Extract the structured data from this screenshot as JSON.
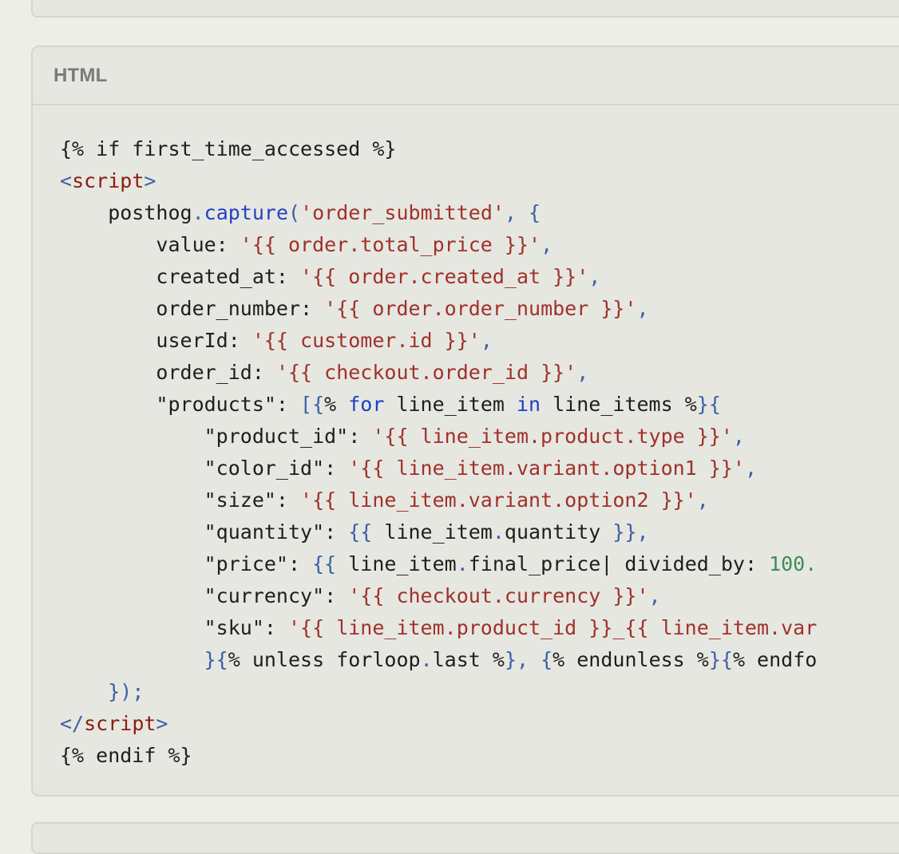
{
  "panel": {
    "label": "HTML"
  },
  "code": {
    "lines": [
      [
        {
          "t": "{% if first_time_accessed %}",
          "c": ""
        }
      ],
      [
        {
          "t": "<",
          "c": "punct"
        },
        {
          "t": "script",
          "c": "tag"
        },
        {
          "t": ">",
          "c": "punct"
        }
      ],
      [
        {
          "t": "    posthog",
          "c": ""
        },
        {
          "t": ".",
          "c": "punct"
        },
        {
          "t": "capture",
          "c": "fn"
        },
        {
          "t": "(",
          "c": "punct"
        },
        {
          "t": "'order_submitted'",
          "c": "str"
        },
        {
          "t": ", ",
          "c": "punct"
        },
        {
          "t": "{",
          "c": "punct"
        }
      ],
      [
        {
          "t": "        value: ",
          "c": ""
        },
        {
          "t": "'{{ order.total_price }}'",
          "c": "str"
        },
        {
          "t": ",",
          "c": "punct"
        }
      ],
      [
        {
          "t": "        created_at: ",
          "c": ""
        },
        {
          "t": "'{{ order.created_at }}'",
          "c": "str"
        },
        {
          "t": ",",
          "c": "punct"
        }
      ],
      [
        {
          "t": "        order_number: ",
          "c": ""
        },
        {
          "t": "'{{ order.order_number }}'",
          "c": "str"
        },
        {
          "t": ",",
          "c": "punct"
        }
      ],
      [
        {
          "t": "        userId: ",
          "c": ""
        },
        {
          "t": "'{{ customer.id }}'",
          "c": "str"
        },
        {
          "t": ",",
          "c": "punct"
        }
      ],
      [
        {
          "t": "        order_id: ",
          "c": ""
        },
        {
          "t": "'{{ checkout.order_id }}'",
          "c": "str"
        },
        {
          "t": ",",
          "c": "punct"
        }
      ],
      [
        {
          "t": "        \"products\": ",
          "c": ""
        },
        {
          "t": "[{",
          "c": "punct"
        },
        {
          "t": "% ",
          "c": ""
        },
        {
          "t": "for",
          "c": "kw"
        },
        {
          "t": " line_item ",
          "c": ""
        },
        {
          "t": "in",
          "c": "kw"
        },
        {
          "t": " line_items %",
          "c": ""
        },
        {
          "t": "}{",
          "c": "punct"
        }
      ],
      [
        {
          "t": "            \"product_id\": ",
          "c": ""
        },
        {
          "t": "'{{ line_item.product.type }}'",
          "c": "str"
        },
        {
          "t": ",",
          "c": "punct"
        }
      ],
      [
        {
          "t": "            \"color_id\": ",
          "c": ""
        },
        {
          "t": "'{{ line_item.variant.option1 }}'",
          "c": "str"
        },
        {
          "t": ",",
          "c": "punct"
        }
      ],
      [
        {
          "t": "            \"size\": ",
          "c": ""
        },
        {
          "t": "'{{ line_item.variant.option2 }}'",
          "c": "str"
        },
        {
          "t": ",",
          "c": "punct"
        }
      ],
      [
        {
          "t": "            \"quantity\": ",
          "c": ""
        },
        {
          "t": "{{",
          "c": "punct"
        },
        {
          "t": " line_item",
          "c": ""
        },
        {
          "t": ".",
          "c": "punct"
        },
        {
          "t": "quantity ",
          "c": ""
        },
        {
          "t": "}},",
          "c": "punct"
        }
      ],
      [
        {
          "t": "            \"price\": ",
          "c": ""
        },
        {
          "t": "{{",
          "c": "punct"
        },
        {
          "t": " line_item",
          "c": ""
        },
        {
          "t": ".",
          "c": "punct"
        },
        {
          "t": "final_price| divided_by: ",
          "c": ""
        },
        {
          "t": "100.",
          "c": "num"
        }
      ],
      [
        {
          "t": "            \"currency\": ",
          "c": ""
        },
        {
          "t": "'{{ checkout.currency }}'",
          "c": "str"
        },
        {
          "t": ",",
          "c": "punct"
        }
      ],
      [
        {
          "t": "            \"sku\": ",
          "c": ""
        },
        {
          "t": "'{{ line_item.product_id }}_{{ line_item.var",
          "c": "str"
        }
      ],
      [
        {
          "t": "            ",
          "c": ""
        },
        {
          "t": "}{",
          "c": "punct"
        },
        {
          "t": "% unless forloop",
          "c": ""
        },
        {
          "t": ".",
          "c": "punct"
        },
        {
          "t": "last %",
          "c": ""
        },
        {
          "t": "}, {",
          "c": "punct"
        },
        {
          "t": "% endunless %",
          "c": ""
        },
        {
          "t": "}{",
          "c": "punct"
        },
        {
          "t": "% endfo",
          "c": ""
        }
      ],
      [
        {
          "t": "    ",
          "c": ""
        },
        {
          "t": "});",
          "c": "punct"
        }
      ],
      [
        {
          "t": "</",
          "c": "punct"
        },
        {
          "t": "script",
          "c": "tag"
        },
        {
          "t": ">",
          "c": "punct"
        }
      ],
      [
        {
          "t": "{% endif %}",
          "c": ""
        }
      ]
    ]
  }
}
